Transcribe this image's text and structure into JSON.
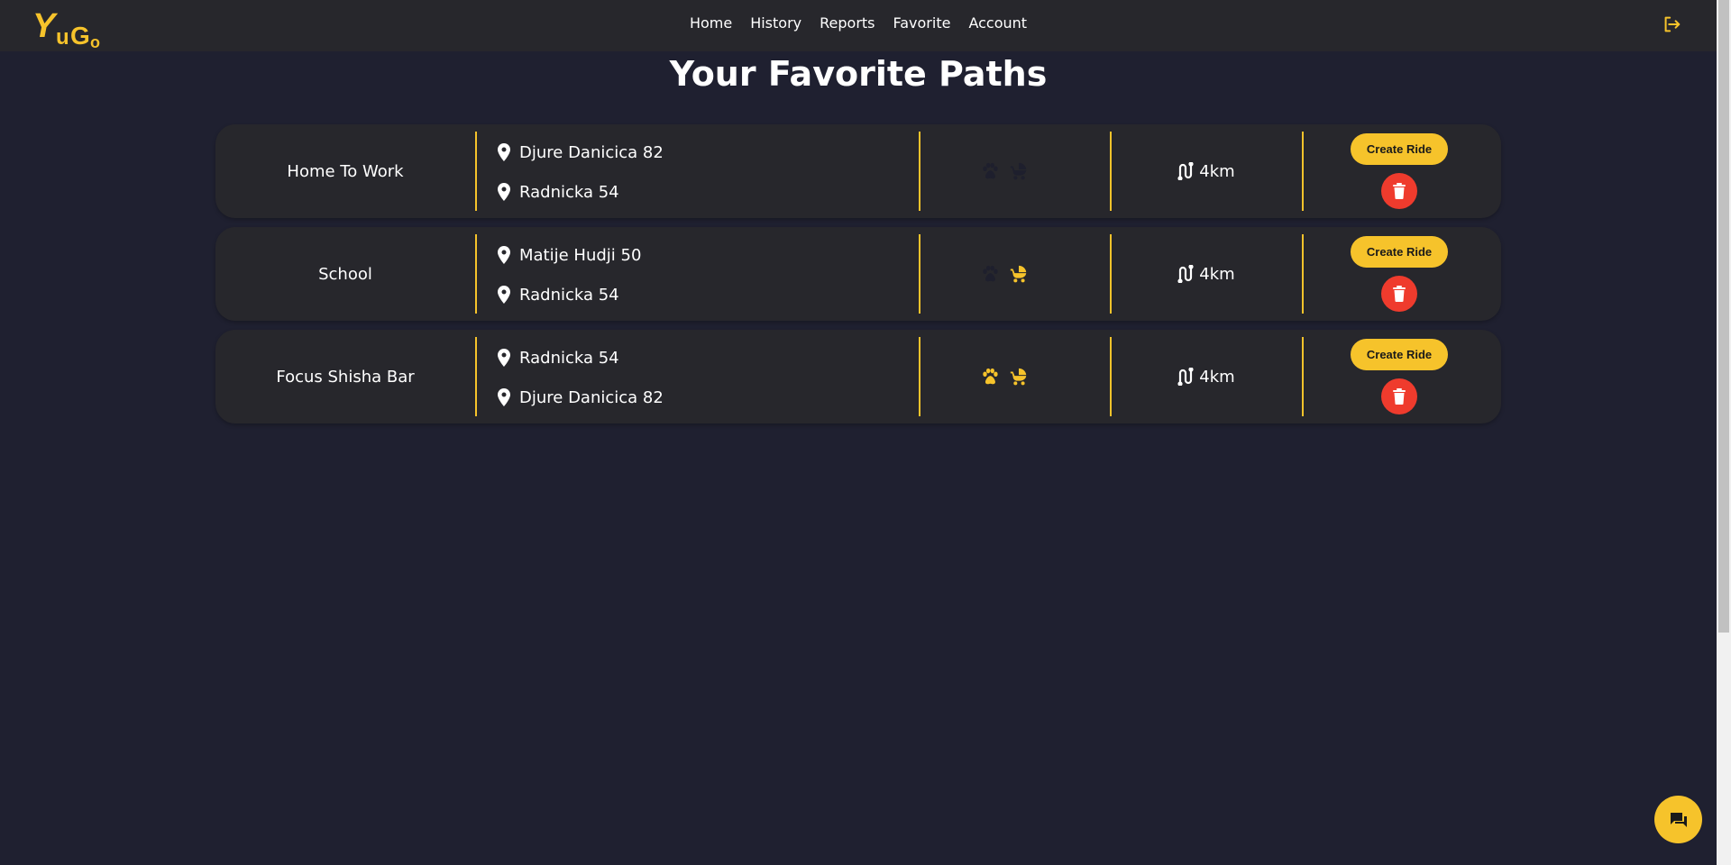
{
  "brand": {
    "logo_text": "YuGo",
    "accent_color": "#f6c32b",
    "danger_color": "#ef3b2d"
  },
  "nav": {
    "items": [
      {
        "label": "Home"
      },
      {
        "label": "History"
      },
      {
        "label": "Reports"
      },
      {
        "label": "Favorite"
      },
      {
        "label": "Account"
      }
    ],
    "logout_icon": "logout-icon"
  },
  "page": {
    "title": "Your Favorite Paths"
  },
  "paths": [
    {
      "name": "Home To Work",
      "from": "Djure Danicica 82",
      "to": "Radnicka 54",
      "pets": false,
      "babies": false,
      "distance": "4km",
      "create_label": "Create Ride"
    },
    {
      "name": "School",
      "from": "Matije Hudji 50",
      "to": "Radnicka 54",
      "pets": false,
      "babies": true,
      "distance": "4km",
      "create_label": "Create Ride"
    },
    {
      "name": "Focus Shisha Bar",
      "from": "Radnicka 54",
      "to": "Djure Danicica 82",
      "pets": true,
      "babies": true,
      "distance": "4km",
      "create_label": "Create Ride"
    }
  ],
  "icons": {
    "location": "location-pin-icon",
    "pets": "paw-icon",
    "babies": "baby-stroller-icon",
    "distance": "route-icon",
    "delete": "trash-icon",
    "chat": "chat-icon"
  }
}
